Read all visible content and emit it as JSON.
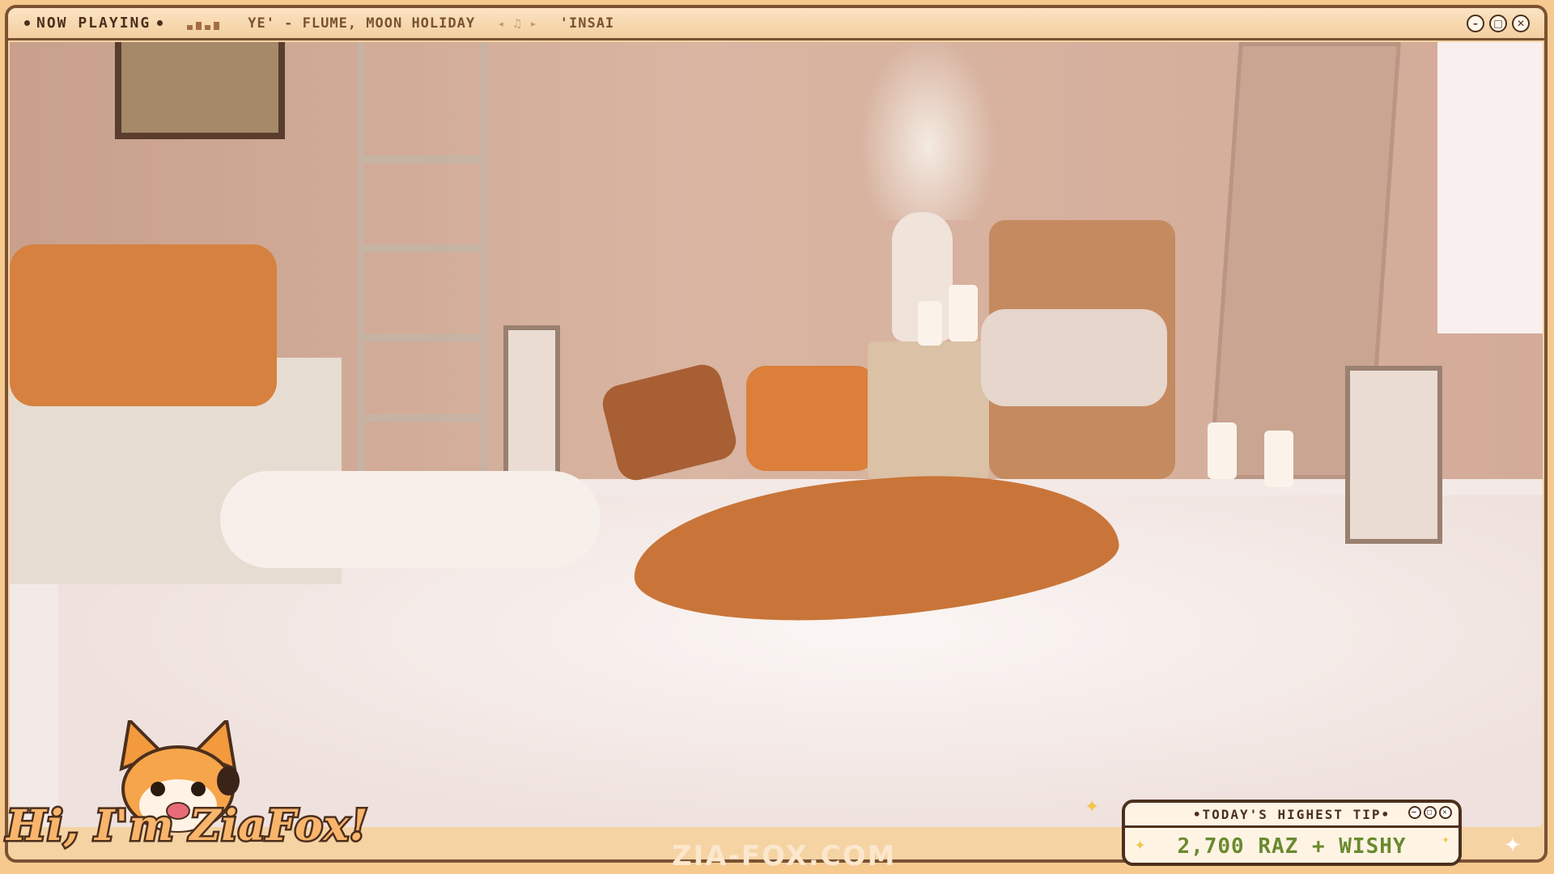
{
  "topbar": {
    "now_playing_label": "NOW PLAYING",
    "track_text": "YE' - FLUME, MOON HOLIDAY",
    "track_next": "'INSAI",
    "notes_glyph": "◂ ♫ ▸",
    "window_buttons": [
      {
        "icon": "minimize-icon",
        "glyph": "–"
      },
      {
        "icon": "maximize-icon",
        "glyph": "□"
      },
      {
        "icon": "close-icon",
        "glyph": "✕"
      }
    ]
  },
  "watermark": "ZIA-FOX.COM",
  "greeting": "Hi, I'm ZiaFox!",
  "tip_box": {
    "heading": "•TODAY'S HIGHEST TIP•",
    "value": "2,700 RAZ + WISHY",
    "buttons": [
      {
        "icon": "minimize-icon",
        "glyph": "–"
      },
      {
        "icon": "maximize-icon",
        "glyph": "□"
      },
      {
        "icon": "close-icon",
        "glyph": "✕"
      }
    ]
  },
  "colors": {
    "frame": "#7a5233",
    "overlay_bg": "#f6d3a3",
    "accent_orange": "#d6813f",
    "tip_value": "#6a8a2e"
  }
}
